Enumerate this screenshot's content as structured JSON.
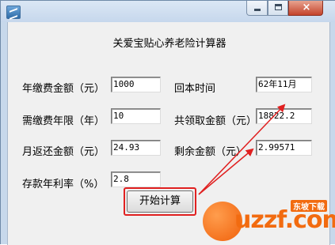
{
  "window": {
    "close_symbol": "×",
    "icons": {
      "app": "app-icon",
      "minimize": "minimize-icon",
      "maximize": "maximize-icon",
      "close": "close-icon"
    }
  },
  "app_title": "关爱宝贴心养老险计算器",
  "fields": {
    "annual_premium": {
      "label": "年缴费金额（元）",
      "value": "1000"
    },
    "payment_years": {
      "label": "需缴费年限（年）",
      "value": "10"
    },
    "monthly_return": {
      "label": "月返还金额（元）",
      "value": "24.93"
    },
    "interest_rate": {
      "label": "存款年利率（%）",
      "value": "2.8"
    },
    "payback_time": {
      "label": "回本时间",
      "value": "62年11月"
    },
    "total_received": {
      "label": "共领取金额（元）",
      "value": "18822.2"
    },
    "remaining_amount": {
      "label": "剩余金额（元）",
      "value": "2.99571"
    }
  },
  "start_button": {
    "label": "开始计算"
  },
  "annotation": {
    "color": "#e02020"
  },
  "watermark": {
    "text": "uzzf.com",
    "subtext": "东坡下载",
    "color": "#f26b10"
  }
}
